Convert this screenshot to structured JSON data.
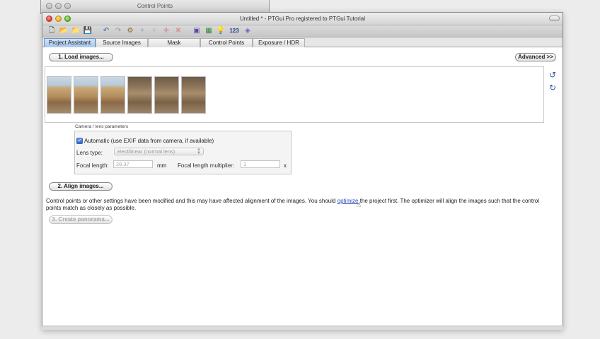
{
  "background_window": {
    "title": "Control Points"
  },
  "window": {
    "title": "Untitled * - PTGui Pro registered to PTGui Tutorial"
  },
  "toolbar": {
    "icons": [
      {
        "name": "new-project-icon",
        "glyph": "🗋"
      },
      {
        "name": "open-project-icon",
        "glyph": "📂"
      },
      {
        "name": "open-recent-icon",
        "glyph": "📁"
      },
      {
        "name": "save-project-icon",
        "glyph": "💾"
      },
      {
        "name": "undo-icon",
        "glyph": "↶"
      },
      {
        "name": "redo-icon",
        "glyph": "↷"
      },
      {
        "name": "gear-icon",
        "glyph": "⚙"
      },
      {
        "name": "panorama-editor-icon",
        "glyph": "▣"
      },
      {
        "name": "table-icon",
        "glyph": "▦"
      },
      {
        "name": "lightbulb-icon",
        "glyph": "💡"
      }
    ],
    "number_button": "123"
  },
  "tabs": [
    {
      "label": "Project Assistant",
      "active": true
    },
    {
      "label": "Source Images"
    },
    {
      "label": "Mask"
    },
    {
      "label": "Control Points"
    },
    {
      "label": "Exposure / HDR"
    }
  ],
  "buttons": {
    "load_images": "1. Load images...",
    "advanced": "Advanced >>",
    "align_images": "2. Align images...",
    "create_panorama": "3. Create panorama..."
  },
  "camera": {
    "legend": "Camera / lens parameters",
    "auto_label": "Automatic (use EXIF data from camera, if available)",
    "auto_checked": true,
    "lens_type_label": "Lens type:",
    "lens_type_value": "Rectilinear (normal lens)",
    "focal_length_label": "Focal length:",
    "focal_length_value": "28.37",
    "focal_unit": "mm",
    "multiplier_label": "Focal length multiplier:",
    "multiplier_value": "1",
    "multiplier_unit": "x"
  },
  "info": {
    "before": "Control points or other settings have been modified and this may have affected alignment of the images. You should ",
    "link": "optimize",
    "after": " the project first. The optimizer will align the images such that the control points match as closely as possible."
  }
}
